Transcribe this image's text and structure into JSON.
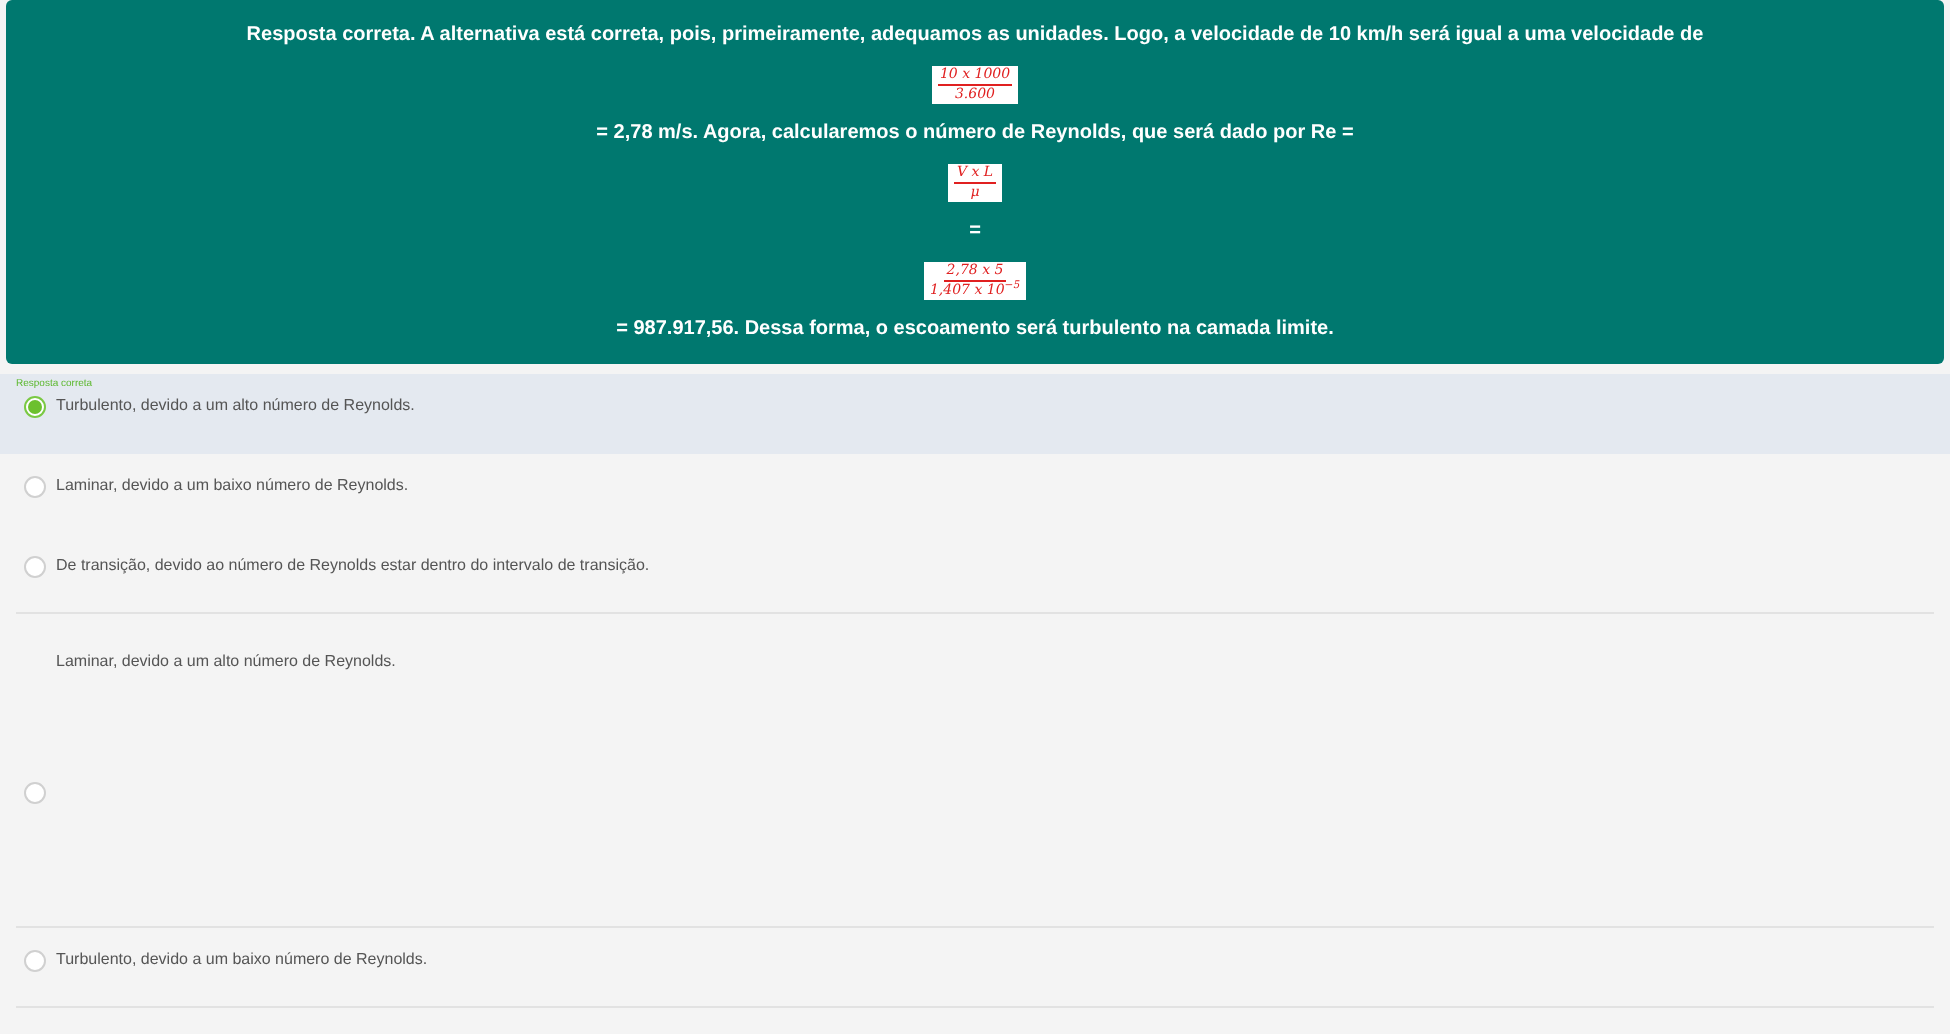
{
  "feedback": [
    {
      "kind": "text",
      "text": "Resposta correta. A alternativa está correta, pois, primeiramente, adequamos as unidades. Logo, a velocidade de 10 km/h será igual a uma velocidade de"
    },
    {
      "kind": "fraction",
      "numerator": "10 x 1000",
      "denominator": "3.600"
    },
    {
      "kind": "text",
      "text": "= 2,78 m/s. Agora, calcularemos o número de Reynolds, que será dado por Re ="
    },
    {
      "kind": "fraction",
      "numerator": "V x L",
      "denominator": "μ"
    },
    {
      "kind": "text",
      "text": "="
    },
    {
      "kind": "fraction",
      "numerator": "2,78 x 5",
      "denominator": "1,407 x 10$^{−5}$"
    },
    {
      "kind": "text",
      "text": "= 987.917,56. Dessa forma, o escoamento será turbulento na camada limite."
    }
  ],
  "options": [
    {
      "kind": "inline",
      "text": "Turbulento, devido a um alto número de Reynolds.",
      "selected": true,
      "note": "Resposta correta"
    },
    {
      "kind": "inline",
      "text": "Laminar, devido a um baixo número de Reynolds.",
      "selected": false
    },
    {
      "kind": "inline",
      "text": "De transição, devido ao número de Reynolds estar dentro do intervalo de transição.",
      "selected": false
    },
    {
      "kind": "stacked",
      "text": "Laminar, devido a um alto número de Reynolds.",
      "selected": false
    },
    {
      "kind": "inline",
      "text": "Turbulento, devido a um baixo número de Reynolds.",
      "selected": false
    }
  ]
}
